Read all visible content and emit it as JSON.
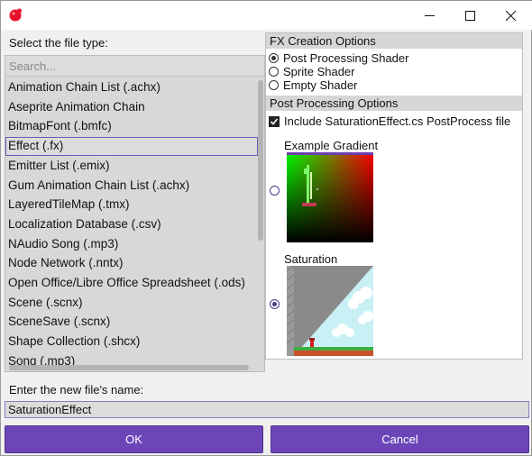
{
  "titlebar": {
    "app_icon": "red-circle-icon",
    "buttons": [
      "minimize-icon",
      "maximize-icon",
      "close-icon"
    ]
  },
  "left": {
    "label": "Select the file type:",
    "search_placeholder": "Search...",
    "items": [
      "Animation Chain List (.achx)",
      "Aseprite Animation Chain",
      "BitmapFont (.bmfc)",
      "Effect (.fx)",
      "Emitter List (.emix)",
      "Gum Animation Chain List (.achx)",
      "LayeredTileMap (.tmx)",
      "Localization Database (.csv)",
      "NAudio Song (.mp3)",
      "Node Network (.nntx)",
      "Open Office/Libre Office Spreadsheet (.ods)",
      "Scene (.scnx)",
      "SceneSave (.scnx)",
      "Shape Collection (.shcx)",
      "Song (.mp3)"
    ],
    "selected_index": 3
  },
  "right": {
    "fx_header": "FX Creation Options",
    "fx_options": [
      "Post Processing Shader",
      "Sprite Shader",
      "Empty Shader"
    ],
    "fx_selected": 0,
    "pp_header": "Post Processing Options",
    "include_label": "Include SaturationEffect.cs PostProcess file",
    "include_checked": true,
    "previews": [
      {
        "label": "Example Gradient",
        "selected": false
      },
      {
        "label": "Saturation",
        "selected": true
      }
    ]
  },
  "bottom": {
    "name_label": "Enter the new file's name:",
    "name_value": "SaturationEffect",
    "ok_label": "OK",
    "cancel_label": "Cancel"
  },
  "colors": {
    "accent": "#6c46b9",
    "selection_border": "#6e58b8",
    "panel_bg": "#d8d8d8"
  }
}
